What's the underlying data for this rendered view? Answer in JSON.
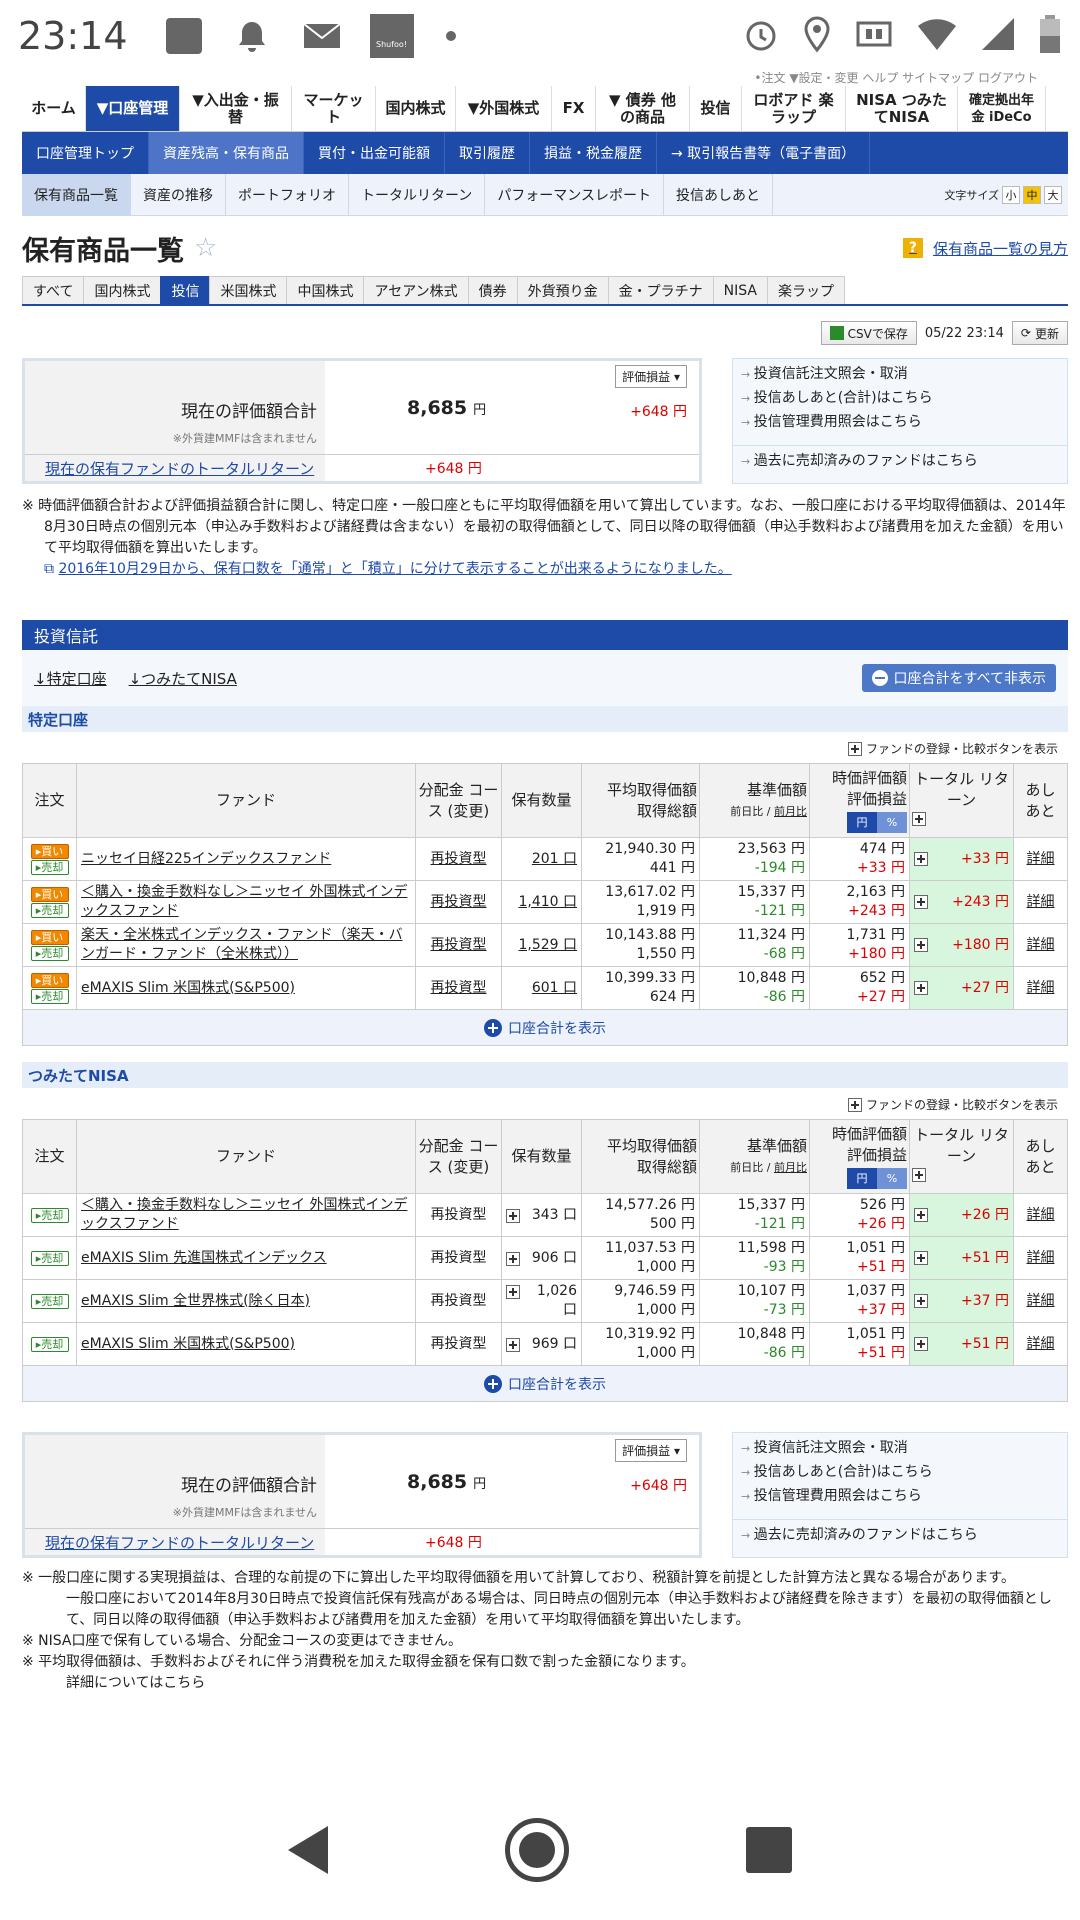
{
  "status": {
    "time": "23:14",
    "shufoo_label": "Shufoo!"
  },
  "top_clip": "•注文 ▼設定・変更 ヘルプ サイトマップ ログアウト",
  "gnav": [
    {
      "label": "ホーム"
    },
    {
      "label": "▼口座管理"
    },
    {
      "label": "▼入出金・振替"
    },
    {
      "label": "マーケット"
    },
    {
      "label": "国内株式"
    },
    {
      "label": "▼外国株式"
    },
    {
      "label": "FX"
    },
    {
      "label": "▼ 債券 他の商品"
    },
    {
      "label": "投信"
    },
    {
      "label": "ロボアド 楽ラップ"
    },
    {
      "label": "NISA つみたてNISA"
    },
    {
      "label": "確定拠出年金 iDeCo"
    }
  ],
  "snav": [
    "口座管理トップ",
    "資産残高・保有商品",
    "買付・出金可能額",
    "取引履歴",
    "損益・税金履歴",
    "→ 取引報告書等（電子書面）"
  ],
  "tnav": [
    "保有商品一覧",
    "資産の推移",
    "ポートフォリオ",
    "トータルリターン",
    "パフォーマンスレポート",
    "投信あしあと"
  ],
  "font_size": {
    "label": "文字サイズ",
    "small": "小",
    "mid": "中",
    "large": "大"
  },
  "page_title": "保有商品一覧",
  "howto": "保有商品一覧の見方",
  "ftabs": [
    "すべて",
    "国内株式",
    "投信",
    "米国株式",
    "中国株式",
    "アセアン株式",
    "債券",
    "外貨預り金",
    "金・プラチナ",
    "NISA",
    "楽ラップ"
  ],
  "tools": {
    "csv": "CSVで保存",
    "datetime": "05/22 23:14",
    "refresh": "更新"
  },
  "summary": {
    "select": "評価損益 ▾",
    "label": "現在の評価額合計",
    "note": "※外貨建MMFは含まれません",
    "value": "8,685",
    "unit": "円",
    "gain": "+648 円",
    "tr_label": "現在の保有ファンドのトータルリターン",
    "tr_value": "+648 円"
  },
  "links": [
    "投資信託注文照会・取消",
    "投信あしあと(合計)はこちら",
    "投信管理費用照会はこちら",
    "過去に売却済みのファンドはこちら"
  ],
  "notes_top": {
    "text": "※ 時価評価額合計および評価損益額合計に関し、特定口座・一般口座ともに平均取得価額を用いて算出しています。なお、一般口座における平均取得価額は、2014年8月30日時点の個別元本（申込み手数料および諸経費は含まない）を最初の取得価額として、同日以降の取得価額（申込手数料および諸費用を加えた金額）を用いて平均取得価額を算出いたします。",
    "link": "2016年10月29日から、保有口数を「通常」と「積立」に分けて表示することが出来るようになりました。"
  },
  "section_title": "投資信託",
  "jumps": [
    "↓特定口座",
    "↓つみたてNISA"
  ],
  "hide_all": "口座合計をすべて非表示",
  "register_btn": "ファンドの登録・比較ボタンを表示",
  "headers": {
    "order": "注文",
    "fund": "ファンド",
    "course": "分配金 コース (変更)",
    "qty": "保有数量",
    "avg1": "平均取得価額",
    "avg2": "取得総額",
    "base1": "基準価額",
    "base2a": "前日比",
    "base2b": "前月比",
    "ev1": "時価評価額",
    "ev2": "評価損益",
    "yen": "円",
    "pct": "%",
    "tr": "トータル リターン",
    "note": "あし あと"
  },
  "order_labels": {
    "buy": "▸買い",
    "sell": "▸売却"
  },
  "show_sum": "口座合計を表示",
  "accounts": [
    {
      "name": "特定口座",
      "rows": [
        {
          "fund": "ニッセイ日経225インデックスファンド",
          "course": "再投資型",
          "qty": "201 口",
          "avg": "21,940.30 円",
          "total": "441 円",
          "base": "23,563 円",
          "diff": "-194 円",
          "ev": "474 円",
          "pl": "+33 円",
          "tr": "+33 円",
          "note": "詳細"
        },
        {
          "fund": "＜購入・換金手数料なし＞ニッセイ 外国株式インデックスファンド",
          "course": "再投資型",
          "qty": "1,410 口",
          "avg": "13,617.02 円",
          "total": "1,919 円",
          "base": "15,337 円",
          "diff": "-121 円",
          "ev": "2,163 円",
          "pl": "+243 円",
          "tr": "+243 円",
          "note": "詳細"
        },
        {
          "fund": "楽天・全米株式インデックス・ファンド（楽天・バンガード・ファンド（全米株式））",
          "course": "再投資型",
          "qty": "1,529 口",
          "avg": "10,143.88 円",
          "total": "1,550 円",
          "base": "11,324 円",
          "diff": "-68 円",
          "ev": "1,731 円",
          "pl": "+180 円",
          "tr": "+180 円",
          "note": "詳細"
        },
        {
          "fund": "eMAXIS Slim 米国株式(S&P500)",
          "course": "再投資型",
          "qty": "601 口",
          "avg": "10,399.33 円",
          "total": "624 円",
          "base": "10,848 円",
          "diff": "-86 円",
          "ev": "652 円",
          "pl": "+27 円",
          "tr": "+27 円",
          "note": "詳細"
        }
      ]
    },
    {
      "name": "つみたてNISA",
      "rows": [
        {
          "fund": "＜購入・換金手数料なし＞ニッセイ 外国株式インデックスファンド",
          "course": "再投資型",
          "qty": "343 口",
          "avg": "14,577.26 円",
          "total": "500 円",
          "base": "15,337 円",
          "diff": "-121 円",
          "ev": "526 円",
          "pl": "+26 円",
          "tr": "+26 円",
          "note": "詳細"
        },
        {
          "fund": "eMAXIS Slim 先進国株式インデックス",
          "course": "再投資型",
          "qty": "906 口",
          "avg": "11,037.53 円",
          "total": "1,000 円",
          "base": "11,598 円",
          "diff": "-93 円",
          "ev": "1,051 円",
          "pl": "+51 円",
          "tr": "+51 円",
          "note": "詳細"
        },
        {
          "fund": "eMAXIS Slim 全世界株式(除く日本)",
          "course": "再投資型",
          "qty": "1,026 口",
          "avg": "9,746.59 円",
          "total": "1,000 円",
          "base": "10,107 円",
          "diff": "-73 円",
          "ev": "1,037 円",
          "pl": "+37 円",
          "tr": "+37 円",
          "note": "詳細"
        },
        {
          "fund": "eMAXIS Slim 米国株式(S&P500)",
          "course": "再投資型",
          "qty": "969 口",
          "avg": "10,319.92 円",
          "total": "1,000 円",
          "base": "10,848 円",
          "diff": "-86 円",
          "ev": "1,051 円",
          "pl": "+51 円",
          "tr": "+51 円",
          "note": "詳細"
        }
      ]
    }
  ],
  "notes_bottom": [
    "※ 一般口座に関する実現損益は、合理的な前提の下に算出した平均取得価額を用いて計算しており、税額計算を前提とした計算方法と異なる場合があります。",
    "一般口座において2014年8月30日時点で投資信託保有残高がある場合は、同日時点の個別元本（申込手数料および諸経費を除きます）を最初の取得価額として、同日以降の取得価額（申込手数料および諸費用を加えた金額）を用いて平均取得価額を算出いたします。",
    "※ NISA口座で保有している場合、分配金コースの変更はできません。",
    "※ 平均取得価額は、手数料およびそれに伴う消費税を加えた取得金額を保有口数で割った金額になります。",
    "詳細についてはこちら"
  ],
  "colors": {
    "brand": "#1e4aa8",
    "gain": "#d00000",
    "loss": "#2b8a2b",
    "tr_bg": "#d8f5dd",
    "buy": "#f08800"
  }
}
